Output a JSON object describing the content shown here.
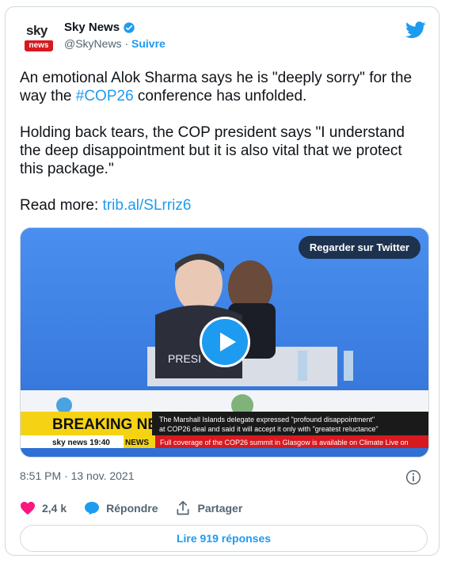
{
  "author": {
    "display_name": "Sky News",
    "handle": "@SkyNews",
    "separator": " · ",
    "follow_label": "Suivre",
    "avatar_sky": "sky",
    "avatar_news": "news"
  },
  "tweet": {
    "paragraph1_prefix": "An emotional Alok Sharma says he is \"deeply sorry\" for the way the ",
    "hashtag": "#COP26",
    "paragraph1_suffix": " conference has unfolded.",
    "paragraph2": "Holding back tears, the COP president says \"I understand the deep disappointment but it is also vital that we protect this package.\"",
    "read_more_label": "Read more: ",
    "read_more_link": "trib.al/SLrriz6"
  },
  "media": {
    "watch_label": "Regarder sur Twitter"
  },
  "meta": {
    "timestamp": "8:51 PM · 13 nov. 2021"
  },
  "actions": {
    "like_count": "2,4 k",
    "reply_label": "Répondre",
    "share_label": "Partager"
  },
  "replies_button": "Lire 919 réponses",
  "colors": {
    "accent": "#1d9bf0",
    "like": "#f91880"
  }
}
